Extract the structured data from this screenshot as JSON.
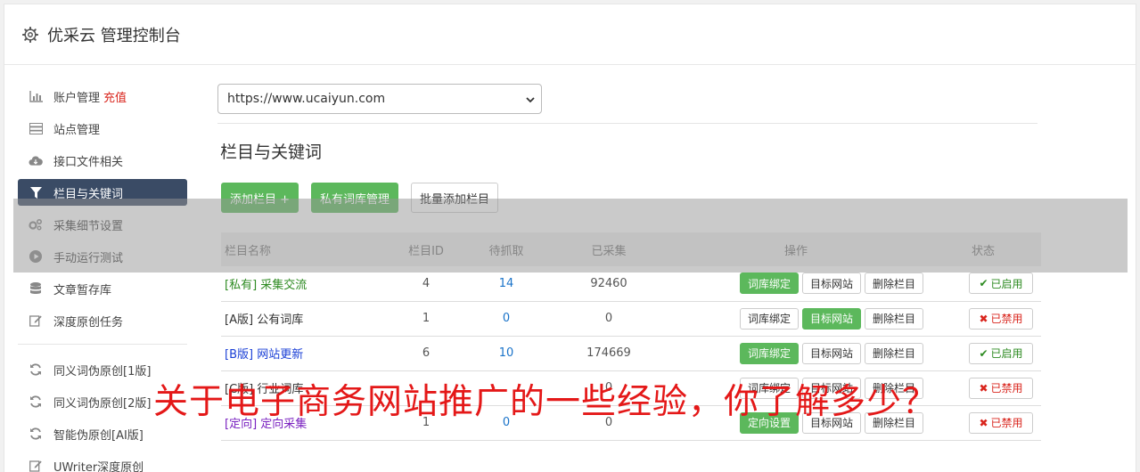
{
  "header": {
    "title": "优采云 管理控制台",
    "icon": "gear-icon"
  },
  "sidebar": {
    "items": [
      {
        "label": "账户管理",
        "extra": "充值",
        "icon": "bar-chart-icon"
      },
      {
        "label": "站点管理",
        "icon": "server-icon"
      },
      {
        "label": "接口文件相关",
        "icon": "cloud-download-icon"
      },
      {
        "label": "栏目与关键词",
        "icon": "filter-icon",
        "active": true
      },
      {
        "label": "采集细节设置",
        "icon": "gears-icon"
      },
      {
        "label": "手动运行测试",
        "icon": "play-circle-icon"
      },
      {
        "label": "文章暂存库",
        "icon": "database-icon"
      },
      {
        "label": "深度原创任务",
        "icon": "edit-icon"
      }
    ],
    "items2": [
      {
        "label": "同义词伪原创[1版]",
        "icon": "refresh-icon"
      },
      {
        "label": "同义词伪原创[2版]",
        "icon": "refresh-icon"
      },
      {
        "label": "智能伪原创[AI版]",
        "icon": "refresh-icon"
      },
      {
        "label": "UWriter深度原创",
        "icon": "edit-icon"
      }
    ]
  },
  "main": {
    "site_select": "https://www.ucaiyun.com",
    "section_title": "栏目与关键词",
    "buttons": {
      "add": "添加栏目 +",
      "private_lib": "私有词库管理",
      "batch_add": "批量添加栏目"
    },
    "table": {
      "headers": {
        "name": "栏目名称",
        "id": "栏目ID",
        "pending": "待抓取",
        "collected": "已采集",
        "ops": "操作",
        "status": "状态"
      },
      "rows": [
        {
          "tag": "[私有]",
          "name": "采集交流",
          "id": "4",
          "pending": "14",
          "collected": "92460",
          "op1": "词库绑定",
          "op2": "目标网站",
          "op3": "删除栏目",
          "status": "已启用"
        },
        {
          "tag": "[A版]",
          "name": "公有词库",
          "id": "1",
          "pending": "0",
          "collected": "0",
          "op1": "词库绑定",
          "op2": "目标网站",
          "op3": "删除栏目",
          "status": "已禁用"
        },
        {
          "tag": "[B版]",
          "name": "网站更新",
          "id": "6",
          "pending": "10",
          "collected": "174669",
          "op1": "词库绑定",
          "op2": "目标网站",
          "op3": "删除栏目",
          "status": "已启用"
        },
        {
          "tag": "[C版]",
          "name": "行业词库",
          "id": "",
          "pending": "",
          "collected": "0",
          "op1": "词库绑定",
          "op2": "目标网站",
          "op3": "删除栏目",
          "status": "已禁用"
        },
        {
          "tag": "[定向]",
          "name": "定向采集",
          "id": "1",
          "pending": "0",
          "collected": "0",
          "op1": "定向设置",
          "op2": "目标网站",
          "op3": "删除栏目",
          "status": "已禁用"
        }
      ]
    }
  },
  "overlay": {
    "title": "关于电子商务网站推广的一些经验，你了解多少？"
  },
  "colors": {
    "accent_green": "#5cb85c",
    "active_nav": "#3a4b65",
    "danger": "#d9251d",
    "link": "#1a73c9",
    "overlay_text": "#e41818"
  }
}
